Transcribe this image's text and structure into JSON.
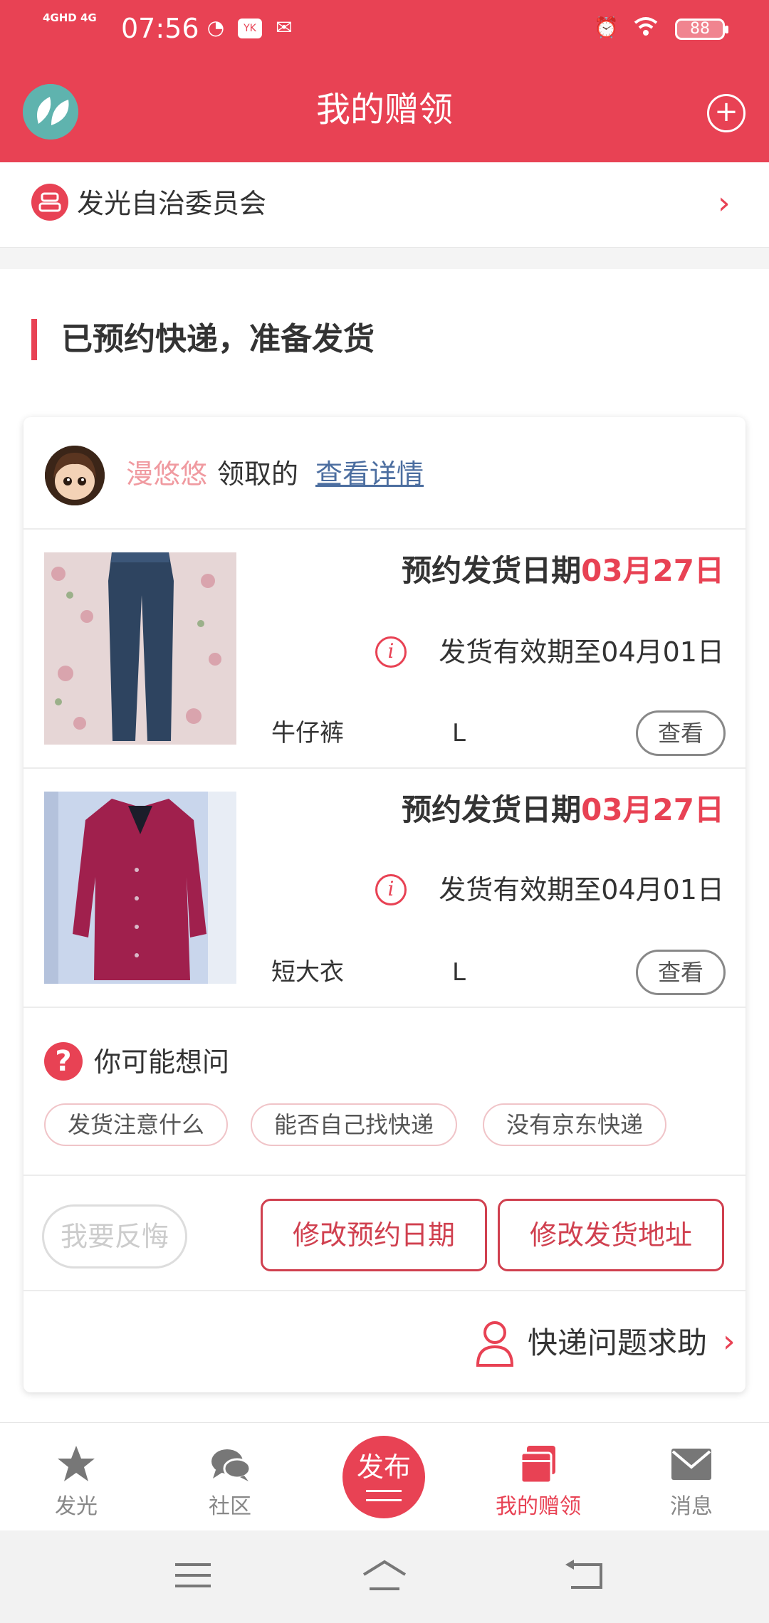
{
  "status_bar": {
    "network": "4GHD 4G",
    "time": "07:56",
    "battery": "88",
    "icons": [
      "signal-icon",
      "clock-app-icon",
      "youku-icon",
      "mail-icon",
      "alarm-icon",
      "wifi-icon",
      "battery-icon"
    ]
  },
  "header": {
    "title": "我的赠领",
    "logo_icon": "leaf-logo-icon",
    "add_icon": "plus-circle-icon"
  },
  "community": {
    "name": "发光自治委员会",
    "icon": "community-icon",
    "chevron": "›"
  },
  "section": {
    "title": "已预约快递，准备发货"
  },
  "claimer": {
    "name": "漫悠悠",
    "verb": "领取的",
    "details_link": "查看详情"
  },
  "items": [
    {
      "date_label": "预约发货日期",
      "date_value": "03月27日",
      "valid_text": "发货有效期至04月01日",
      "name": "牛仔裤",
      "size": "L",
      "view_label": "查看"
    },
    {
      "date_label": "预约发货日期",
      "date_value": "03月27日",
      "valid_text": "发货有效期至04月01日",
      "name": "短大衣",
      "size": "L",
      "view_label": "查看"
    }
  ],
  "faq": {
    "title": "你可能想问",
    "chips": [
      "发货注意什么",
      "能否自己找快递",
      "没有京东快递"
    ]
  },
  "actions": {
    "regret": "我要反悔",
    "change_date": "修改预约日期",
    "change_address": "修改发货地址"
  },
  "help": {
    "label": "快递问题求助"
  },
  "tabbar": {
    "tabs": [
      {
        "label": "发光",
        "icon": "star-icon"
      },
      {
        "label": "社区",
        "icon": "chat-bubbles-icon"
      },
      {
        "label": "发布",
        "icon": "publish-icon"
      },
      {
        "label": "我的赠领",
        "icon": "gift-box-icon"
      },
      {
        "label": "消息",
        "icon": "envelope-icon"
      }
    ],
    "active": "我的赠领"
  },
  "colors": {
    "brand": "#e84254",
    "link": "#4c6ea0",
    "username": "#f09aa0"
  }
}
